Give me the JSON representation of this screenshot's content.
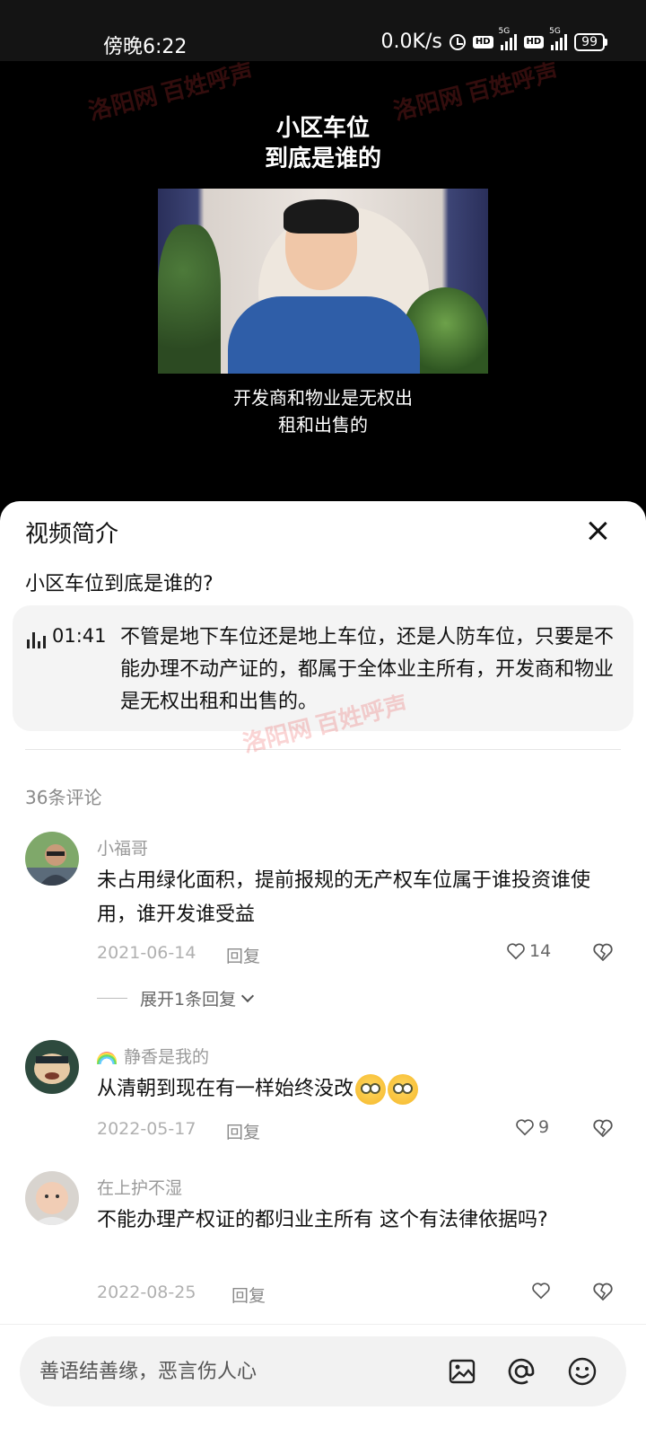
{
  "status_bar": {
    "time": "傍晚6:22",
    "network_speed": "0.0K/s",
    "hd1": "HD",
    "net1": "5G",
    "hd2": "HD",
    "net2": "5G",
    "battery": "99"
  },
  "video": {
    "title_line1": "小区车位",
    "title_line2": "到底是谁的",
    "caption_line1": "开发商和物业是无权出",
    "caption_line2": "租和出售的"
  },
  "sheet": {
    "title": "视频简介",
    "video_name": "小区车位到底是谁的?",
    "chapter": {
      "timestamp": "01:41",
      "text": "不管是地下车位还是地上车位，还是人防车位，只要是不能办理不动产证的，都属于全体业主所有，开发商和物业是无权出租和出售的。"
    },
    "comment_count": "36条评论",
    "comments": [
      {
        "user": "小福哥",
        "text": "未占用绿化面积，提前报规的无产权车位属于谁投资谁使用，谁开发谁受益",
        "date": "2021-06-14",
        "reply": "回复",
        "likes": "14",
        "expand": "展开1条回复"
      },
      {
        "user": "静香是我的",
        "text": "从清朝到现在有一样始终没改",
        "date": "2022-05-17",
        "reply": "回复",
        "likes": "9"
      },
      {
        "user": "在上护不湿",
        "text": "不能办理产权证的都归业主所有   这个有法律依据吗?",
        "date": "2022-08-25",
        "reply": "回复",
        "likes": ""
      }
    ]
  },
  "input": {
    "placeholder": "善语结善缘，恶言伤人心"
  },
  "watermark": {
    "site": "洛阳网",
    "brand": "百姓呼声"
  },
  "icons": [
    "alarm-clock-icon",
    "close-icon",
    "audio-wave-icon",
    "heart-icon",
    "dislike-heart-icon",
    "chevron-down-icon",
    "image-icon",
    "at-icon",
    "emoji-icon",
    "rainbow-icon"
  ],
  "colors": {
    "status_bg": "#141414",
    "sheet_bg": "#ffffff",
    "chapter_bg": "#f4f4f4",
    "input_bg": "#f2f2f2",
    "muted": "#9a9a9a"
  }
}
